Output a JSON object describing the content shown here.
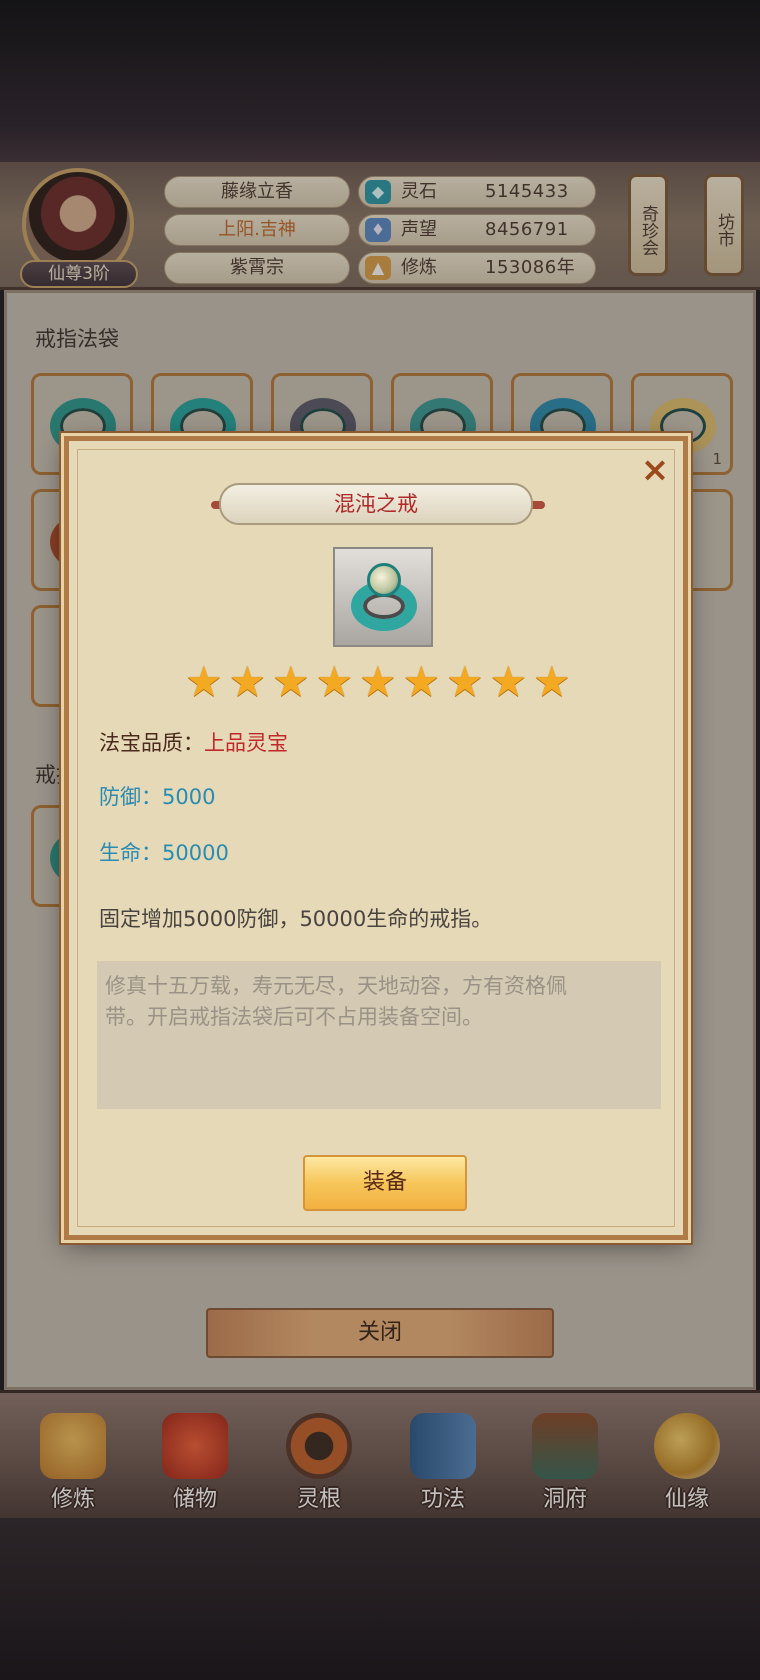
{
  "player": {
    "rank": "仙尊3阶",
    "name": "藤缘立香",
    "title": "上阳.吉神",
    "sect": "紫霄宗"
  },
  "stats": [
    {
      "label": "灵石",
      "value": "5145433",
      "icon": "spirit-stone-icon"
    },
    {
      "label": "声望",
      "value": "8456791",
      "icon": "reputation-crystal-icon"
    },
    {
      "label": "修炼",
      "value": "153086年",
      "icon": "meditation-icon"
    }
  ],
  "side_buttons": {
    "treasure_fair": "奇珍会",
    "market": "坊市"
  },
  "main": {
    "section1_title": "戒指法袋",
    "section2_title": "戒指",
    "slot_count_label": "1",
    "close_label": "关闭"
  },
  "modal": {
    "title": "混沌之戒",
    "star_count": 9,
    "quality_label": "法宝品质：",
    "quality_value": "上品灵宝",
    "defense": "防御：5000",
    "hp": "生命：50000",
    "description": "固定增加5000防御，50000生命的戒指。",
    "flavor_line1": "修真十五万载，寿元无尽，天地动容，方有资格佩",
    "flavor_line2": "带。开启戒指法袋后可不占用装备空间。",
    "equip_label": "装备",
    "close_icon": "×"
  },
  "nav": [
    {
      "label": "修炼",
      "icon": "meditation-figure-icon"
    },
    {
      "label": "储物",
      "icon": "storage-bag-icon"
    },
    {
      "label": "灵根",
      "icon": "spirit-root-icon"
    },
    {
      "label": "功法",
      "icon": "technique-book-icon"
    },
    {
      "label": "洞府",
      "icon": "cave-dwelling-icon"
    },
    {
      "label": "仙缘",
      "icon": "immortal-fate-icon"
    }
  ],
  "colors": {
    "modal_bg": "#e6d9b8",
    "quality": "#c0282a",
    "attribute": "#2a8cb0",
    "star": "#f3a921",
    "equip_button": "#f6c65a"
  }
}
